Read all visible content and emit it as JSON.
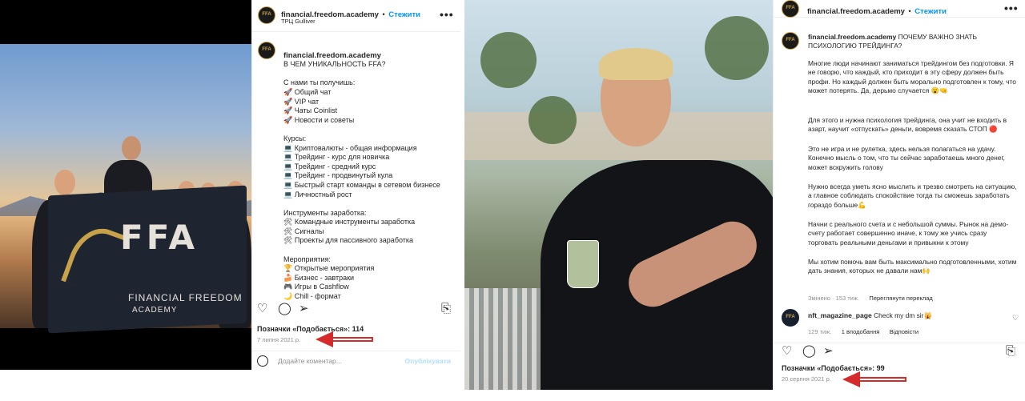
{
  "left_post": {
    "username": "financial.freedom.academy",
    "dot": "•",
    "follow": "Стежити",
    "location": "ТРЦ Gulliver",
    "more": "•••",
    "photo": {
      "flag_logo": "FFA",
      "flag_line1": "FINANCIAL FREEDOM",
      "flag_line2": "ACADEMY"
    },
    "caption": {
      "author": "financial.freedom.academy",
      "title": "В ЧЕМ УНИКАЛЬНОСТЬ FFA?",
      "lines": [
        "",
        "С нами ты получишь:",
        "🚀 Общий чат",
        "🚀 VIP чат",
        "🚀 Чаты Coinlist",
        "🚀 Новости и советы",
        "",
        "Курсы:",
        "💻 Криптовалюты - общая информация",
        "💻 Трейдинг - курс для новичка",
        "💻 Трейдинг - средний курс",
        "💻 Трейдинг - продвинутый кула",
        "💻 Быстрый старт команды в сетевом бизнесе",
        "💻 Личностный рост",
        "",
        "Инструменты заработка:",
        "🛠 Командные инструменты заработка",
        "🛠 Сигналы",
        "🛠 Проекты для пассивного заработка",
        "",
        "Мероприятия:",
        "🏆 Открытые мероприятия",
        "🍰 Бизнес - завтраки",
        "🎮 Игры в Cashflow",
        "🌙 Chill - формат"
      ]
    },
    "likes": "Позначки «Подобається»: 114",
    "date": "7 липня 2021 р.",
    "comment_placeholder": "Додайте коментар...",
    "publish": "Опублікувати"
  },
  "right_post": {
    "username": "financial.freedom.academy",
    "dot": "•",
    "follow": "Стежити",
    "more": "•••",
    "caption": {
      "author": "financial.freedom.academy",
      "title": "ПОЧЕМУ ВАЖНО ЗНАТЬ ПСИХОЛОГИЮ ТРЕЙДИНГА?",
      "p1": "Многие люди начинают заниматься трейдингом без подготовки. Я не говорю, что каждый, кто приходит в эту сферу должен быть профи. Но каждый должен быть морально подготовлен к тому, что может потерять. Да, дерьмо случается 😮🤜",
      "p2": "Для этого и нужна психология трейдинга, она учит не входить в азарт, научит «отпускать» деньги, вовремя сказать СТОП 🔴",
      "p3": "Это не игра и не рулетка, здесь нельзя полагаться на удачу. Конечно мысль о том, что ты сейчас заработаешь много денег, может вскружить голову",
      "p4": "Нужно всегда уметь ясно мыслить и трезво смотреть на ситуацию, а главное соблюдать спокойствие тогда ты сможешь заработать гораздо больше💪",
      "p5": "Начни с реального счета и с небольшой суммы. Рынок на демо-счету работает совершенно иначе, к тому же учись сразу торговать реальными деньгами и привыкни к этому",
      "p6": "Мы хотим помочь вам быть максимально подготовленными, хотим дать знания, которых не давали нам🙌"
    },
    "caption_meta": "Змінено · 153 тиж.",
    "see_translation": "Переглянути переклад",
    "comment": {
      "username": "nft_magazine_page",
      "text": "Check my dm sir🙀",
      "age": "129 тиж.",
      "likes": "1 вподобання",
      "reply": "Відповісти"
    },
    "likes": "Позначки «Подобається»: 99",
    "date": "20 серпня 2021 р."
  }
}
